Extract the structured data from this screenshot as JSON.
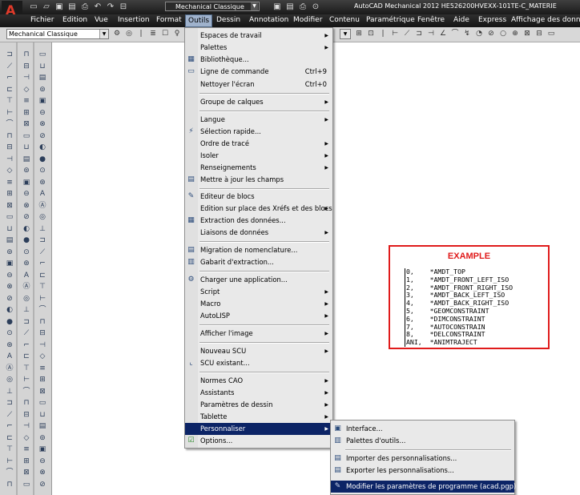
{
  "titlebar": {
    "logo_letter": "A",
    "logo_sub": "M",
    "workspace": "Mechanical Classique",
    "title": "AutoCAD Mechanical 2012   HE526200HVEXX-101TE-C_MATERIE"
  },
  "menubar": {
    "items": [
      "Fichier",
      "Edition",
      "Vue",
      "Insertion",
      "Format",
      "Outils",
      "Dessin",
      "Annotation",
      "Modifier",
      "Contenu",
      "Paramétrique",
      "Fenêtre",
      "Aide",
      "Express",
      "Affichage des données"
    ],
    "active": "Outils"
  },
  "toolbar": {
    "workspace_combo": "Mechanical Classique"
  },
  "tools_menu": {
    "items": [
      {
        "label": "Espaces de travail",
        "submenu": true
      },
      {
        "label": "Palettes",
        "submenu": true
      },
      {
        "label": "Bibliothèque...",
        "icon": "library-icon"
      },
      {
        "label": "Ligne de commande",
        "shortcut": "Ctrl+9",
        "icon": "command-line-icon"
      },
      {
        "label": "Nettoyer l'écran",
        "shortcut": "Ctrl+0"
      },
      {
        "label": "Groupe de calques",
        "submenu": true
      },
      {
        "label": "Langue",
        "submenu": true
      },
      {
        "label": "Sélection rapide...",
        "icon": "quick-select-icon"
      },
      {
        "label": "Ordre de tracé",
        "submenu": true
      },
      {
        "label": "Isoler",
        "submenu": true
      },
      {
        "label": "Renseignements",
        "submenu": true
      },
      {
        "label": "Mettre à jour les champs",
        "icon": "update-fields-icon"
      },
      {
        "label": "Editeur de blocs",
        "icon": "block-editor-icon"
      },
      {
        "label": "Edition sur place des Xréfs et des blocs",
        "submenu": true
      },
      {
        "label": "Extraction des données...",
        "icon": "data-extraction-icon"
      },
      {
        "label": "Liaisons de données",
        "submenu": true
      },
      {
        "label": "Migration de nomenclature...",
        "icon": "bom-migration-icon"
      },
      {
        "label": "Gabarit d'extraction...",
        "icon": "extraction-template-icon"
      },
      {
        "label": "Charger une application...",
        "icon": "load-application-icon"
      },
      {
        "label": "Script",
        "submenu": true
      },
      {
        "label": "Macro",
        "submenu": true
      },
      {
        "label": "AutoLISP",
        "submenu": true
      },
      {
        "label": "Afficher l'image",
        "submenu": true
      },
      {
        "label": "Nouveau SCU",
        "submenu": true
      },
      {
        "label": "SCU existant...",
        "icon": "ucs-icon"
      },
      {
        "label": "Normes CAO",
        "submenu": true
      },
      {
        "label": "Assistants",
        "submenu": true
      },
      {
        "label": "Paramètres de dessin",
        "submenu": true
      },
      {
        "label": "Tablette",
        "submenu": true
      },
      {
        "label": "Personnaliser",
        "submenu": true,
        "highlighted": true
      },
      {
        "label": "Options...",
        "icon": "options-check-icon"
      }
    ]
  },
  "customize_submenu": {
    "items": [
      {
        "label": "Interface...",
        "icon": "interface-icon"
      },
      {
        "label": "Palettes d'outils...",
        "icon": "tool-palettes-icon"
      },
      {
        "label": "Importer des personnalisations...",
        "icon": "import-customizations-icon"
      },
      {
        "label": "Exporter les personnalisations...",
        "icon": "export-customizations-icon"
      },
      {
        "label": "Modifier les paramètres de programme (acad.pgp)",
        "icon": "edit-pgp-icon",
        "highlighted": true
      }
    ]
  },
  "example": {
    "title": "EXAMPLE",
    "lines": [
      "0,    *AMDT_TOP",
      "1,    *AMDT_FRONT_LEFT_ISO",
      "2,    *AMDT_FRONT_RIGHT_ISO",
      "3,    *AMDT_BACK_LEFT_ISO",
      "4,    *AMDT_BACK_RIGHT_ISO",
      "5,    *GEOMCONSTRAINT",
      "6,    *DIMCONSTRAINT",
      "7,    *AUTOCONSTRAIN",
      "8,    *DELCONSTRAINT",
      "ANI,  *ANIMTRAJECT"
    ]
  },
  "colors": {
    "menu_highlight": "#0c2466",
    "example_border": "#e01b1b",
    "title_bar": "#1a1a1a"
  }
}
